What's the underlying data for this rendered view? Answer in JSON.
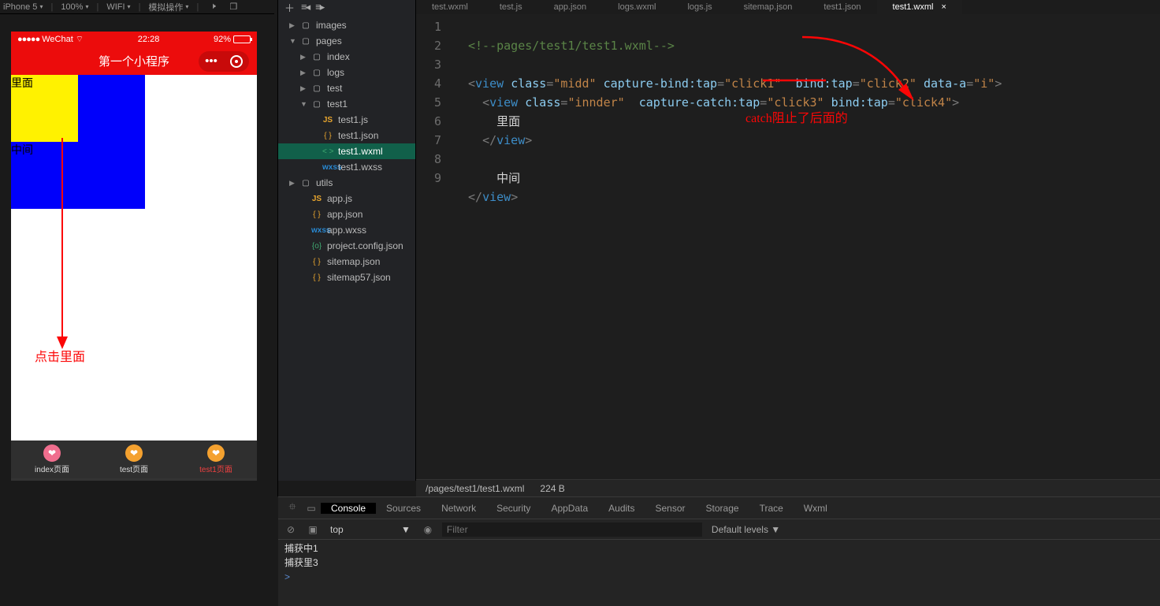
{
  "toolbar": {
    "device": "iPhone 5",
    "zoom": "100%",
    "network": "WIFI",
    "sim_action": "模拟操作"
  },
  "simulator": {
    "carrier": "WeChat",
    "time": "22:28",
    "battery": "92%",
    "title": "第一个小程序",
    "inner_label": "里面",
    "mid_label": "中间",
    "click_text": "点击里面",
    "tabs": [
      {
        "label": "index页面",
        "active": false
      },
      {
        "label": "test页面",
        "active": false
      },
      {
        "label": "test1页面",
        "active": true
      }
    ]
  },
  "tree": [
    {
      "ar": "▶",
      "ico": "folder",
      "label": "images",
      "ind": 0
    },
    {
      "ar": "▼",
      "ico": "folder",
      "label": "pages",
      "ind": 0
    },
    {
      "ar": "▶",
      "ico": "folder",
      "label": "index",
      "ind": 1
    },
    {
      "ar": "▶",
      "ico": "folder",
      "label": "logs",
      "ind": 1
    },
    {
      "ar": "▶",
      "ico": "folder",
      "label": "test",
      "ind": 1
    },
    {
      "ar": "▼",
      "ico": "folder",
      "label": "test1",
      "ind": 1
    },
    {
      "ar": "",
      "ico": "js",
      "label": "test1.js",
      "ind": 2
    },
    {
      "ar": "",
      "ico": "json",
      "label": "test1.json",
      "ind": 2
    },
    {
      "ar": "",
      "ico": "wxml",
      "label": "test1.wxml",
      "ind": 2,
      "sel": true
    },
    {
      "ar": "",
      "ico": "wxss",
      "label": "test1.wxss",
      "ind": 2
    },
    {
      "ar": "▶",
      "ico": "folder",
      "label": "utils",
      "ind": 0
    },
    {
      "ar": "",
      "ico": "js",
      "label": "app.js",
      "ind": 1
    },
    {
      "ar": "",
      "ico": "json",
      "label": "app.json",
      "ind": 1
    },
    {
      "ar": "",
      "ico": "wxss",
      "label": "app.wxss",
      "ind": 1
    },
    {
      "ar": "",
      "ico": "cfg",
      "label": "project.config.json",
      "ind": 1
    },
    {
      "ar": "",
      "ico": "json",
      "label": "sitemap.json",
      "ind": 1
    },
    {
      "ar": "",
      "ico": "json",
      "label": "sitemap57.json",
      "ind": 1
    }
  ],
  "editor_tabs": [
    {
      "label": "test.wxml"
    },
    {
      "label": "test.js"
    },
    {
      "label": "app.json"
    },
    {
      "label": "logs.wxml"
    },
    {
      "label": "logs.js"
    },
    {
      "label": "sitemap.json"
    },
    {
      "label": "test1.json"
    },
    {
      "label": "test1.wxml",
      "active": true
    }
  ],
  "code": {
    "l1_cmt": "<!--pages/test1/test1.wxml-->",
    "tag_view": "view",
    "attr_class": "class",
    "v_midd": "\"midd\"",
    "attr_cbt": "capture-bind:tap",
    "v_click1": "\"click1\"",
    "attr_bt": "bind:tap",
    "v_click2": "\"click2\"",
    "attr_da": "data-a",
    "v_i": "\"i\"",
    "v_innder": "\"innder\"",
    "attr_cct": "capture-catch:tap",
    "v_click3": "\"click3\"",
    "v_click4": "\"click4\"",
    "txt_inner": "里面",
    "txt_mid": "中间"
  },
  "line_numbers": [
    "1",
    "2",
    "3",
    "4",
    "5",
    "6",
    "7",
    "8",
    "9"
  ],
  "annotation": "catch阻止了后面的",
  "status": {
    "path": "/pages/test1/test1.wxml",
    "size": "224 B"
  },
  "devtools": {
    "tabs": [
      "Console",
      "Sources",
      "Network",
      "Security",
      "AppData",
      "Audits",
      "Sensor",
      "Storage",
      "Trace",
      "Wxml"
    ],
    "active": "Console",
    "context": "top",
    "filter_ph": "Filter",
    "levels": "Default levels ▼",
    "rows": [
      "捕获中1",
      "捕获里3"
    ]
  }
}
